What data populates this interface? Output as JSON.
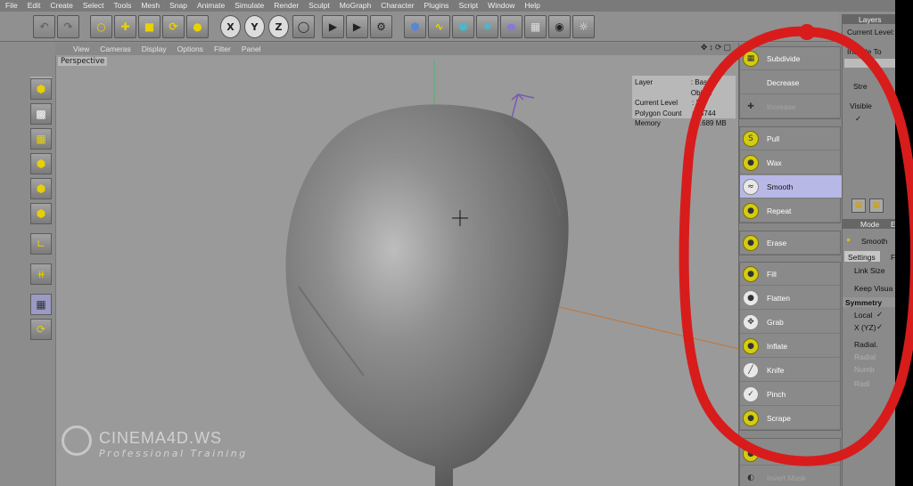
{
  "menu": [
    "File",
    "Edit",
    "Create",
    "Select",
    "Tools",
    "Mesh",
    "Snap",
    "Animate",
    "Simulate",
    "Render",
    "Sculpt",
    "MoGraph",
    "Character",
    "Plugins",
    "Script",
    "Window",
    "Help"
  ],
  "toolbar": {
    "icons": [
      "undo-icon",
      "redo-icon",
      "live-selection-icon",
      "move-icon",
      "scale-icon",
      "rotate-icon",
      "last-tool-icon",
      "x-axis-icon",
      "y-axis-icon",
      "z-axis-icon",
      "coordinate-system-icon",
      "render-view-icon",
      "render-picture-viewer-icon",
      "edit-render-settings-icon",
      "cube-icon",
      "spline-icon",
      "nurbs-icon",
      "array-icon",
      "deformer-icon",
      "floor-icon",
      "camera-icon",
      "light-icon"
    ],
    "axis_labels": [
      "X",
      "Y",
      "Z"
    ]
  },
  "viewport": {
    "menu": [
      "View",
      "Cameras",
      "Display",
      "Options",
      "Filter",
      "Panel"
    ],
    "label": "Perspective",
    "hud": [
      {
        "key": "Layer",
        "value": ": Base Object"
      },
      {
        "key": "Current Level",
        "value": ": 3"
      },
      {
        "key": "Polygon Count",
        "value": ": 15744"
      },
      {
        "key": "Memory",
        "value": ": 5.689 MB"
      }
    ],
    "watermark": {
      "title": "CINEMA4D.WS",
      "subtitle": "Professional Training"
    }
  },
  "brushes": {
    "group1": [
      {
        "label": "Subdivide",
        "icon": "subdivide-icon",
        "state": "normal"
      },
      {
        "label": "Decrease",
        "icon": "decrease-icon",
        "state": "normal"
      },
      {
        "label": "Increase",
        "icon": "increase-icon",
        "state": "disabled"
      }
    ],
    "group2": [
      {
        "label": "Pull",
        "icon": "pull-brush-icon",
        "state": "normal"
      },
      {
        "label": "Wax",
        "icon": "wax-brush-icon",
        "state": "normal"
      },
      {
        "label": "Smooth",
        "icon": "smooth-brush-icon",
        "state": "active"
      },
      {
        "label": "Repeat",
        "icon": "repeat-brush-icon",
        "state": "normal"
      }
    ],
    "group3": [
      {
        "label": "Erase",
        "icon": "erase-brush-icon",
        "state": "normal"
      }
    ],
    "group4": [
      {
        "label": "Fill",
        "icon": "fill-brush-icon",
        "state": "normal"
      },
      {
        "label": "Flatten",
        "icon": "flatten-brush-icon",
        "state": "normal"
      },
      {
        "label": "Grab",
        "icon": "grab-brush-icon",
        "state": "normal"
      },
      {
        "label": "Inflate",
        "icon": "inflate-brush-icon",
        "state": "normal"
      },
      {
        "label": "Knife",
        "icon": "knife-brush-icon",
        "state": "normal"
      },
      {
        "label": "Pinch",
        "icon": "pinch-brush-icon",
        "state": "normal"
      },
      {
        "label": "Scrape",
        "icon": "scrape-brush-icon",
        "state": "normal"
      }
    ],
    "group5": [
      {
        "label": "",
        "icon": "brush-icon",
        "state": "normal"
      },
      {
        "label": "Invert Mask",
        "icon": "invert-mask-icon",
        "state": "disabled"
      }
    ]
  },
  "right_panel": {
    "layers_tab": "Layers",
    "current_level": "Current Level:",
    "include": "Include To",
    "strength": "Stre",
    "visible": "Visible",
    "mode_tab": "Mode",
    "mode_e": "E",
    "tool_name": "Smooth",
    "settings_tab": "Settings",
    "settings_f": "F",
    "link_size": "Link Size",
    "keep_visual": "Keep Visua",
    "symmetry": "Symmetry",
    "local": "Local",
    "xyz": "X (YZ)",
    "radial": "Radial.",
    "radial2": "Radial",
    "number": "Numb",
    "radial3": "Radi"
  },
  "colors": {
    "annotation": "#d81c1c",
    "active_brush": "#b8b8e6",
    "mesh": "#858585",
    "accent_yellow": "#e8d200"
  }
}
